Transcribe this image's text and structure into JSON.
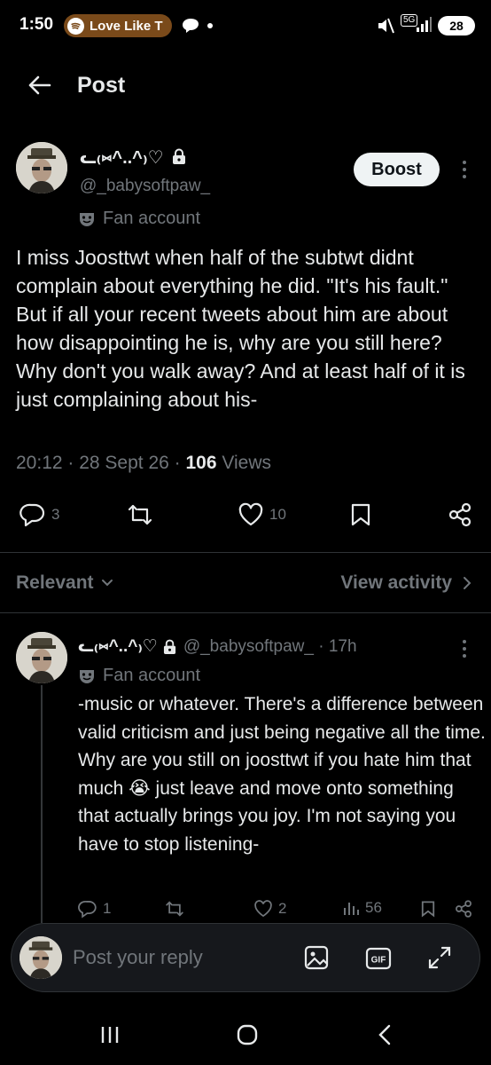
{
  "status_bar": {
    "time": "1:50",
    "spotify_label": "Love Like T",
    "network": "5G",
    "battery": "28"
  },
  "header": {
    "title": "Post"
  },
  "post": {
    "display_name": "ᓚ₍⑅^..^₎♡",
    "handle": "@_babysoftpaw_",
    "boost_label": "Boost",
    "fan_label": "Fan account",
    "text": "I miss Joosttwt when half of the subtwt didnt complain about everything he did. \"It's his fault.\" But if all your recent tweets about him are about how disappointing he is, why are you still here? Why don't you walk away? And at least half of it is just complaining about his-",
    "time": "20:12",
    "date": "28 Sept 26",
    "views_count": "106",
    "views_label": "Views",
    "replies": "3",
    "likes": "10"
  },
  "filter": {
    "relevant_label": "Relevant",
    "view_activity_label": "View activity"
  },
  "reply": {
    "display_name": "ᓚ₍⑅^..^₎♡",
    "handle_time": "@_babysoftpaw_ · 17h",
    "fan_label": "Fan account",
    "text": "-music or whatever. There's a difference between valid criticism and just being negative all the time. Why are you still on joosttwt if you hate him that much 😭 just leave and move onto something that actually brings you joy. I'm not saying you have to stop listening-",
    "replies": "1",
    "likes": "2",
    "views": "56"
  },
  "composer": {
    "placeholder": "Post your reply"
  },
  "icons": {
    "accent": "#1d9bf0",
    "text": "#e7e9ea",
    "muted": "#71767b"
  }
}
